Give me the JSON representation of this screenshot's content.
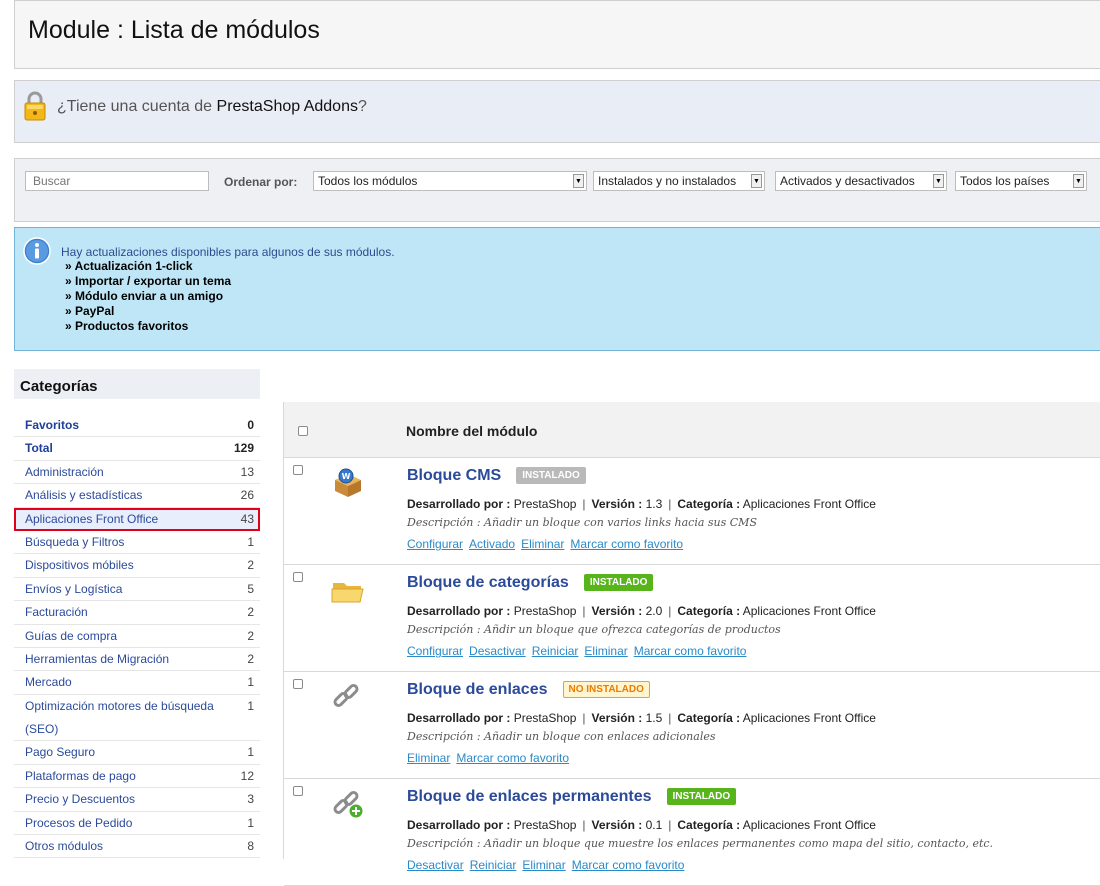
{
  "page": {
    "title": "Module : Lista de módulos"
  },
  "addons": {
    "prefix": "¿Tiene una cuenta de",
    "brand": "PrestaShop Addons",
    "suffix": "?"
  },
  "filters": {
    "search_placeholder": "Buscar",
    "sort_label": "Ordenar por:",
    "module_select": "Todos los módulos",
    "install_select": "Instalados y no instalados",
    "active_select": "Activados y desactivados",
    "country_select": "Todos los países"
  },
  "updates": {
    "message": "Hay actualizaciones disponibles para algunos de sus módulos.",
    "items": [
      "» Actualización 1-click",
      "» Importar / exportar un tema",
      "» Módulo enviar a un amigo",
      "» PayPal",
      "» Productos favoritos"
    ]
  },
  "categories": {
    "title": "Categorías",
    "items": [
      {
        "label": "Favoritos",
        "count": "0"
      },
      {
        "label": "Total",
        "count": "129"
      },
      {
        "label": "Administración",
        "count": "13"
      },
      {
        "label": "Análisis y estadísticas",
        "count": "26"
      },
      {
        "label": "Aplicaciones Front Office",
        "count": "43"
      },
      {
        "label": "Búsqueda y Filtros",
        "count": "1"
      },
      {
        "label": "Dispositivos móbiles",
        "count": "2"
      },
      {
        "label": "Envíos y Logística",
        "count": "5"
      },
      {
        "label": "Facturación",
        "count": "2"
      },
      {
        "label": "Guías de compra",
        "count": "2"
      },
      {
        "label": "Herramientas de Migración",
        "count": "2"
      },
      {
        "label": "Mercado",
        "count": "1"
      },
      {
        "label": "Optimización motores de búsqueda (SEO)",
        "count": "1"
      },
      {
        "label": "Pago Seguro",
        "count": "1"
      },
      {
        "label": "Plataformas de pago",
        "count": "12"
      },
      {
        "label": "Precio y Descuentos",
        "count": "3"
      },
      {
        "label": "Procesos de Pedido",
        "count": "1"
      },
      {
        "label": "Otros módulos",
        "count": "8"
      }
    ]
  },
  "modules": {
    "header": "Nombre del módulo",
    "labels": {
      "dev": "Desarrollado por :",
      "version": "Versión :",
      "category": "Categoría :",
      "sep": "|"
    },
    "rows": [
      {
        "name": "Bloque CMS",
        "status": "INSTALADO",
        "developer": "PrestaShop",
        "version": "1.3",
        "category": "Aplicaciones Front Office",
        "description": "Descripción : Añadir un bloque con varios links hacia sus CMS",
        "actions": [
          "Configurar",
          "Activado",
          "Eliminar",
          "Marcar como favorito"
        ]
      },
      {
        "name": "Bloque de categorías",
        "status": "INSTALADO",
        "developer": "PrestaShop",
        "version": "2.0",
        "category": "Aplicaciones Front Office",
        "description": "Descripción : Añdir un bloque que ofrezca categorías de productos",
        "actions": [
          "Configurar",
          "Desactivar",
          "Reiniciar",
          "Eliminar",
          "Marcar como favorito"
        ]
      },
      {
        "name": "Bloque de enlaces",
        "status": "NO INSTALADO",
        "developer": "PrestaShop",
        "version": "1.5",
        "category": "Aplicaciones Front Office",
        "description": "Descripción : Añadir un bloque con enlaces adicionales",
        "actions": [
          "Eliminar",
          "Marcar como favorito"
        ]
      },
      {
        "name": "Bloque de enlaces permanentes",
        "status": "INSTALADO",
        "developer": "PrestaShop",
        "version": "0.1",
        "category": "Aplicaciones Front Office",
        "description": "Descripción : Añadir un bloque que muestre los enlaces permanentes como mapa del sitio, contacto, etc.",
        "actions": [
          "Desactivar",
          "Reiniciar",
          "Eliminar",
          "Marcar como favorito"
        ]
      }
    ]
  },
  "colors": {
    "link": "#2b4a9a",
    "installed": "#57b41b",
    "disabled_badge": "#b9b9b9",
    "not_installed": "#ee7a00",
    "highlight": "#e0001b"
  },
  "icons": [
    "lock-icon",
    "info-icon",
    "cms-box-icon",
    "folder-icon",
    "link-icon",
    "link-add-icon"
  ]
}
